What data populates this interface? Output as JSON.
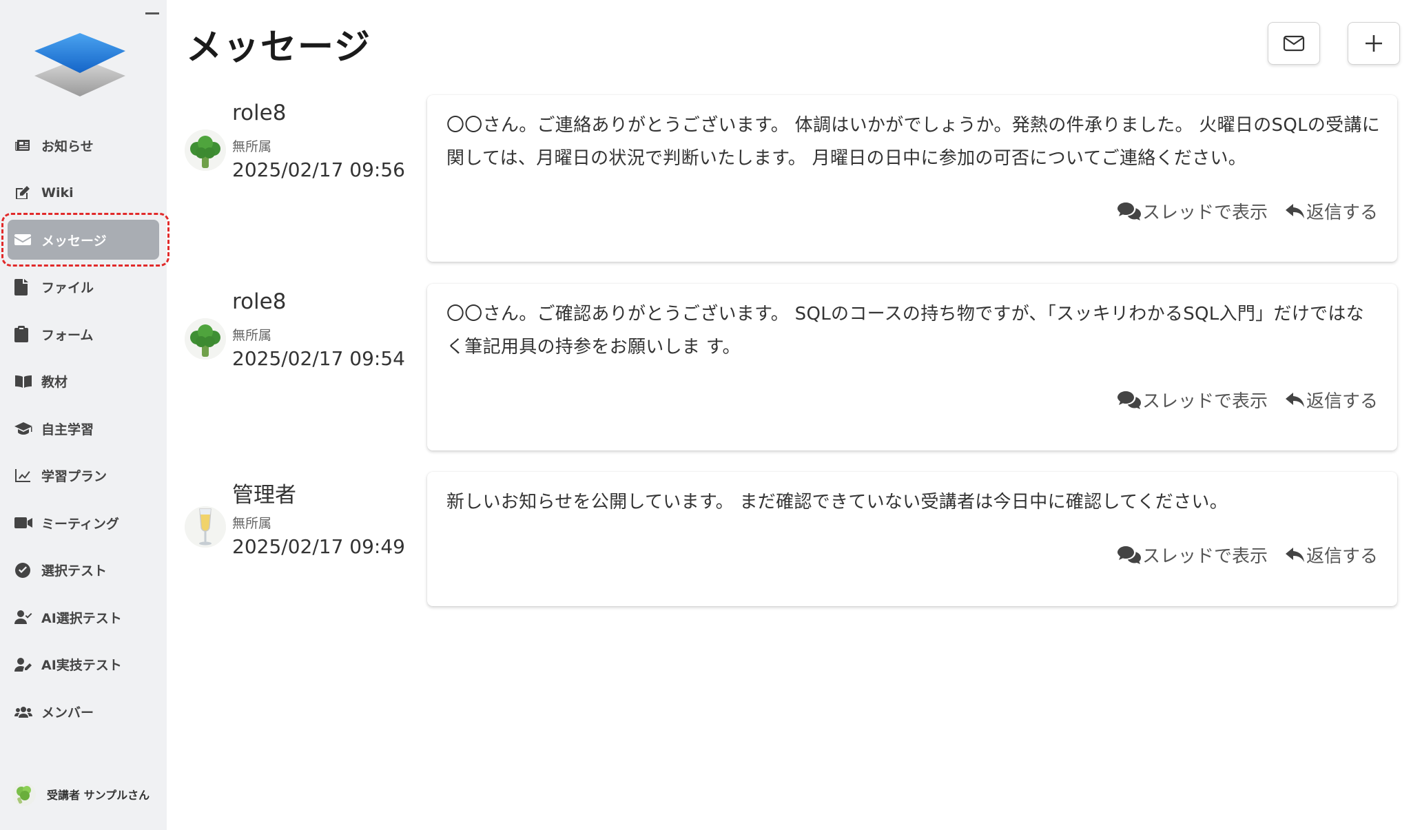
{
  "app": {
    "page_title": "メッセージ",
    "user_name": "受講者 サンプルさん"
  },
  "sidebar": {
    "items": [
      {
        "label": "お知らせ",
        "icon": "newspaper-icon"
      },
      {
        "label": "Wiki",
        "icon": "edit-icon"
      },
      {
        "label": "メッセージ",
        "icon": "envelope-icon",
        "active": true
      },
      {
        "label": "ファイル",
        "icon": "file-icon"
      },
      {
        "label": "フォーム",
        "icon": "clipboard-icon"
      },
      {
        "label": "教材",
        "icon": "book-icon"
      },
      {
        "label": "自主学習",
        "icon": "graduation-cap-icon"
      },
      {
        "label": "学習プラン",
        "icon": "chart-line-icon"
      },
      {
        "label": "ミーティング",
        "icon": "video-icon"
      },
      {
        "label": "選択テスト",
        "icon": "check-circle-icon"
      },
      {
        "label": "AI選択テスト",
        "icon": "user-check-icon"
      },
      {
        "label": "AI実技テスト",
        "icon": "user-pen-icon"
      },
      {
        "label": "メンバー",
        "icon": "users-icon"
      }
    ]
  },
  "messages": [
    {
      "author": "role8",
      "department": "無所属",
      "timestamp": "2025/02/17 09:56",
      "avatar": "broccoli",
      "body": "〇〇さん。ご連絡ありがとうございます。 体調はいかがでしょうか。発熱の件承りました。 火曜日のSQLの受講に関しては、月曜日の状況で判断いたします。 月曜日の日中に参加の可否についてご連絡ください。"
    },
    {
      "author": "role8",
      "department": "無所属",
      "timestamp": "2025/02/17 09:54",
      "avatar": "broccoli",
      "body": "〇〇さん。ご確認ありがとうございます。 SQLのコースの持ち物ですが、「スッキリわかるSQL入門」だけではなく筆記用具の持参をお願いしま す。"
    },
    {
      "author": "管理者",
      "department": "無所属",
      "timestamp": "2025/02/17 09:49",
      "avatar": "champagne",
      "body": "新しいお知らせを公開しています。 まだ確認できていない受講者は今日中に確認してください。"
    }
  ],
  "actions": {
    "thread_label": "スレッドで表示",
    "reply_label": "返信する"
  },
  "colors": {
    "sidebar_bg": "#f0f1f3",
    "active_bg": "#a9adb3",
    "highlight": "#e12a2a"
  }
}
